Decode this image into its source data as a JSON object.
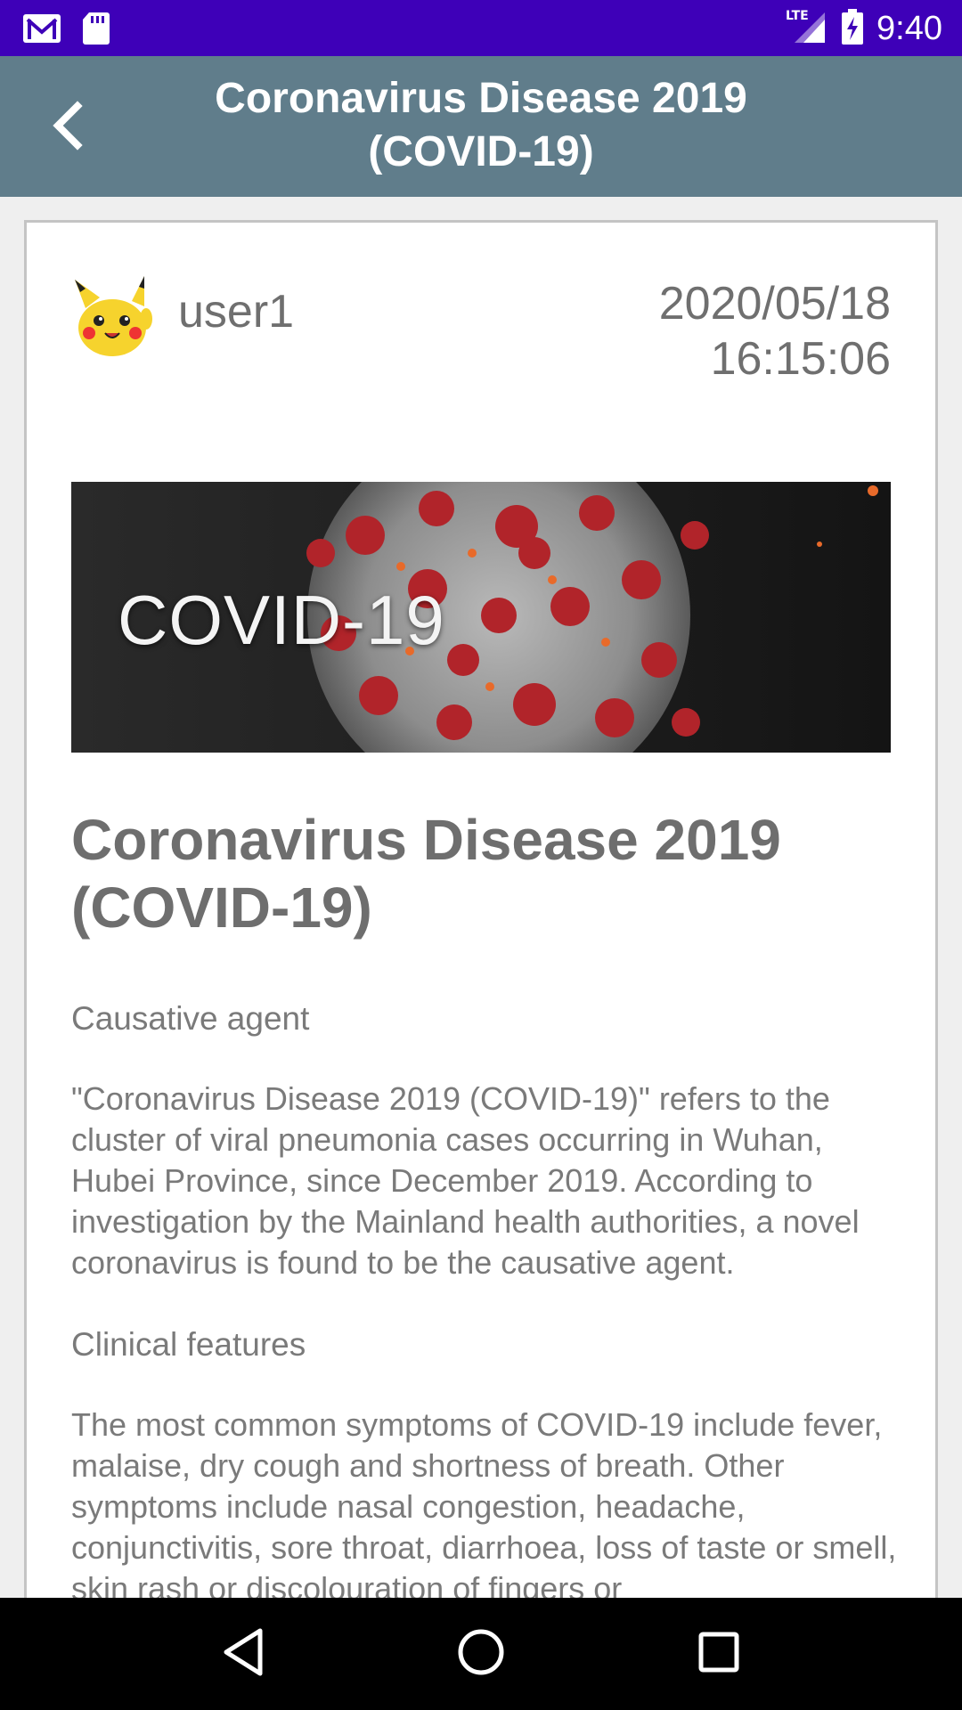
{
  "status_bar": {
    "time": "9:40",
    "network": "LTE",
    "icons": [
      "gmail-icon",
      "sd-card-icon",
      "signal-icon",
      "battery-charging-icon"
    ]
  },
  "app_bar": {
    "title_line1": "Coronavirus Disease 2019",
    "title_line2": "(COVID-19)",
    "back_icon": "chevron-left-icon"
  },
  "post": {
    "username": "user1",
    "date": "2020/05/18",
    "time": "16:15:06",
    "banner_text": "COVID-19",
    "title_line1": "Coronavirus Disease 2019",
    "title_line2": "(COVID-19)",
    "section1_heading": "Causative agent",
    "section1_body": "\"Coronavirus Disease 2019 (COVID-19)\" refers to the cluster of viral pneumonia cases occurring in Wuhan, Hubei Province, since December 2019. According to investigation by the Mainland health authorities, a novel coronavirus is found to be the causative agent.",
    "section2_heading": "Clinical features",
    "section2_body": "The most common symptoms of COVID-19 include fever, malaise, dry cough and shortness of breath. Other symptoms include nasal congestion, headache, conjunctivitis, sore throat, diarrhoea, loss of taste or smell, skin rash or discolouration of fingers or"
  },
  "nav_bar": {
    "icons": [
      "back-triangle-icon",
      "home-circle-icon",
      "recents-square-icon"
    ]
  },
  "colors": {
    "status_bar": "#3e00b8",
    "app_bar": "#607d8b",
    "background": "#efefef",
    "text_gray": "#7a7a7a"
  }
}
